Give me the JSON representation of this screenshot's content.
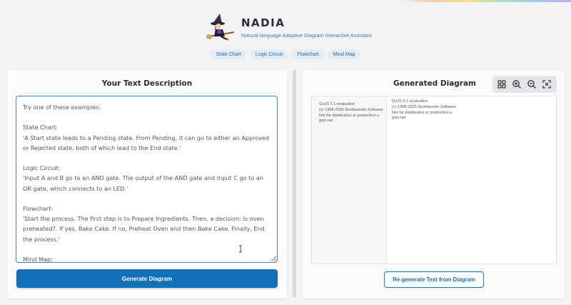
{
  "app": {
    "title": "NADIA",
    "subtitle": "Natural-language Adaptive Diagram Interactive Assistant"
  },
  "examples_nav": [
    {
      "label": "State Chart"
    },
    {
      "label": "Logic Circuit"
    },
    {
      "label": "Flowchart"
    },
    {
      "label": "Mind Map"
    }
  ],
  "left_panel": {
    "title": "Your Text Description",
    "textarea_value": "Try one of these examples:\n\nState Chart:\n'A Start state leads to a Pending state. From Pending, it can go to either an Approved or Rejected state, both of which lead to the End state.'\n\nLogic Circuit:\n'Input A and B go to an AND gate. The output of the AND gate and Input C go to an OR gate, which connects to an LED.'\n\nFlowchart:\n'Start the process. The first step is to Prepare Ingredients. Then, a decision: Is oven preheated?. If yes, Bake Cake. If no, Preheat Oven and then Bake Cake. Finally, End the process.'\n\nMind Map:\n'A mind map about effective project management. The main branches are Planning, Execution,",
    "generate_label": "Generate Diagram"
  },
  "right_panel": {
    "title": "Generated Diagram",
    "toolbar": [
      {
        "icon": "layout-grid-icon"
      },
      {
        "icon": "zoom-in-icon"
      },
      {
        "icon": "zoom-out-icon"
      },
      {
        "icon": "fit-to-screen-icon"
      }
    ],
    "watermark": {
      "line1": "GoJS 3.1 evaluation",
      "line2": "(c) 1998-2025 Northwoods Software",
      "line3": "Not for distribution or production u",
      "line4": "gojs.net"
    },
    "regenerate_label": "Re-generate Text from Diagram"
  },
  "colors": {
    "primary": "#1270b8",
    "accent_text": "#1e6fb0",
    "background": "#f2f3f4",
    "panel": "#fbfbfb"
  }
}
